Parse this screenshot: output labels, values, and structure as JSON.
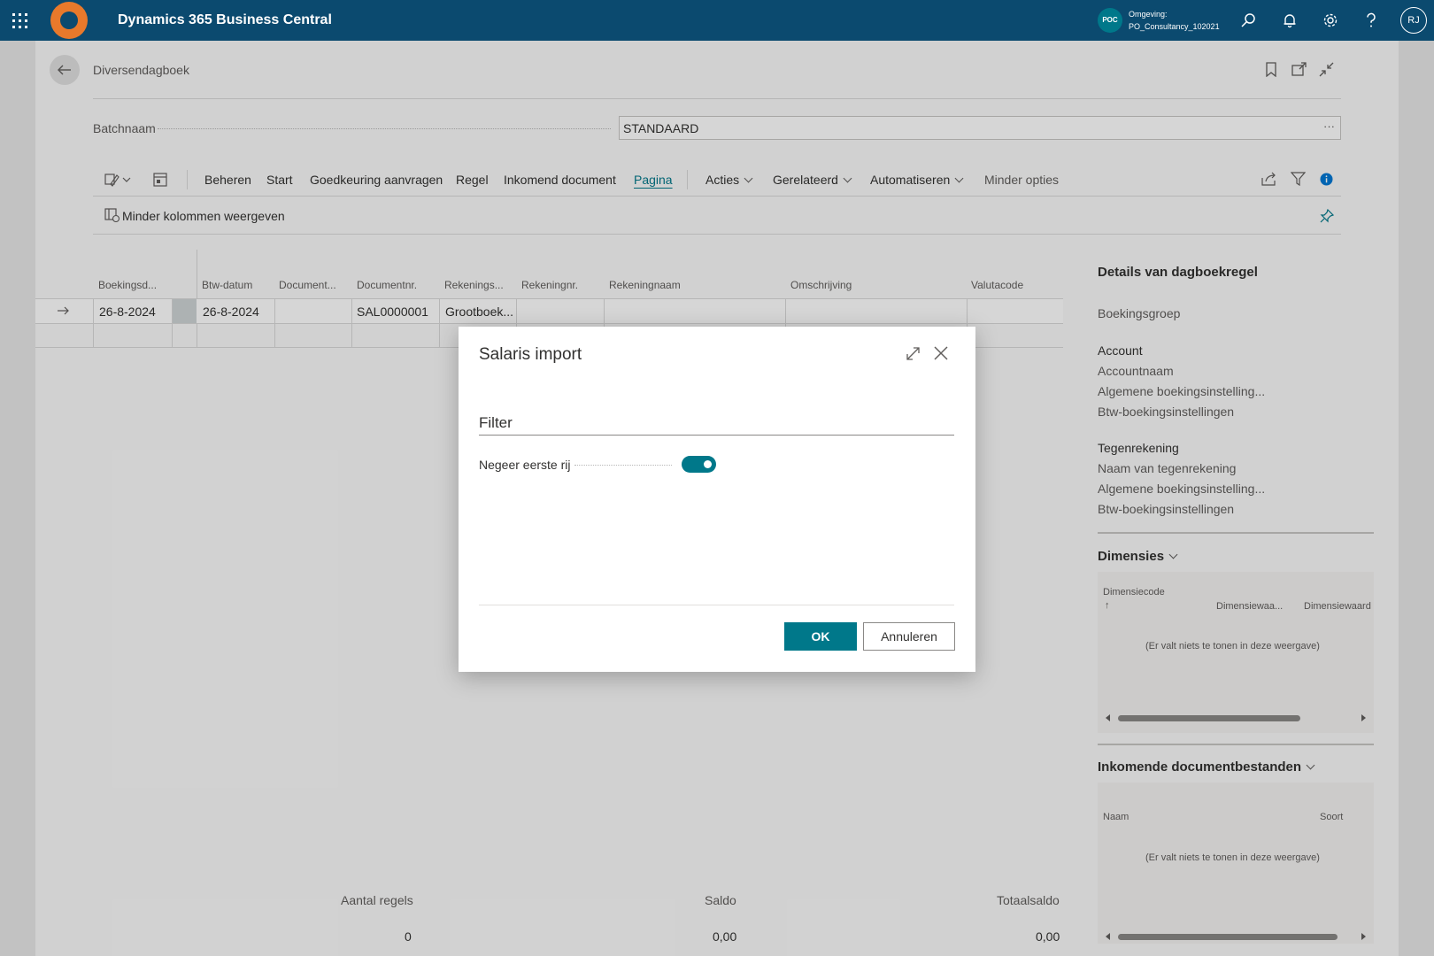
{
  "app": {
    "title": "Dynamics 365 Business Central",
    "env_badge": "POC",
    "env_label": "Omgeving:",
    "env_name": "PO_Consultancy_102021",
    "avatar": "RJ",
    "icons": [
      "waffle-icon",
      "logo-icon",
      "search-icon",
      "bell-icon",
      "gear-icon",
      "help-icon"
    ]
  },
  "page": {
    "title": "Diversendagboek",
    "batch_label": "Batchnaam",
    "batch_value": "STANDAARD",
    "batch_more": "···"
  },
  "actionbar": {
    "items": [
      "Beheren",
      "Start",
      "Goedkeuring aanvragen",
      "Regel",
      "Inkomend document",
      "Pagina",
      "Acties",
      "Gerelateerd",
      "Automatiseren",
      "Minder opties"
    ],
    "active": "Pagina",
    "fewer_columns": "Minder kolommen weergeven"
  },
  "grid": {
    "headers": [
      "Boekingsd...",
      "Btw-datum",
      "Document...",
      "Documentnr.",
      "Rekenings...",
      "Rekeningnr.",
      "Rekeningnaam",
      "Omschrijving",
      "Valutacode"
    ],
    "row": {
      "boekingsdatum": "26-8-2024",
      "btw_datum": "26-8-2024",
      "documentnr": "SAL0000001",
      "rekeningsoort": "Grootboek..."
    }
  },
  "totals": {
    "labels": [
      "Aantal regels",
      "Saldo",
      "Totaalsaldo"
    ],
    "values": [
      "0",
      "0,00",
      "0,00"
    ]
  },
  "factbox": {
    "title": "Details van dagboekregel",
    "boekingsgroep": "Boekingsgroep",
    "account": "Account",
    "account_items": [
      "Accountnaam",
      "Algemene boekingsinstelling...",
      "Btw-boekingsinstellingen"
    ],
    "tegenrekening": "Tegenrekening",
    "tegen_items": [
      "Naam van tegenrekening",
      "Algemene boekingsinstelling...",
      "Btw-boekingsinstellingen"
    ],
    "dimensies": {
      "title": "Dimensies",
      "col1": "Dimensiecode",
      "col2": "Dimensiewaa...",
      "col3": "Dimensiewaard",
      "empty": "(Er valt niets te tonen in deze weergave)"
    },
    "inkomende": {
      "title": "Inkomende documentbestanden",
      "col1": "Naam",
      "col2": "Soort",
      "empty": "(Er valt niets te tonen in deze weergave)"
    }
  },
  "dialog": {
    "title": "Salaris import",
    "section": "Filter",
    "toggle_label": "Negeer eerste rij",
    "toggle_on": true,
    "ok": "OK",
    "cancel": "Annuleren"
  },
  "colors": {
    "topbar": "#0b4a6f",
    "accent": "#00788a",
    "logo_orange": "#e8792b"
  }
}
